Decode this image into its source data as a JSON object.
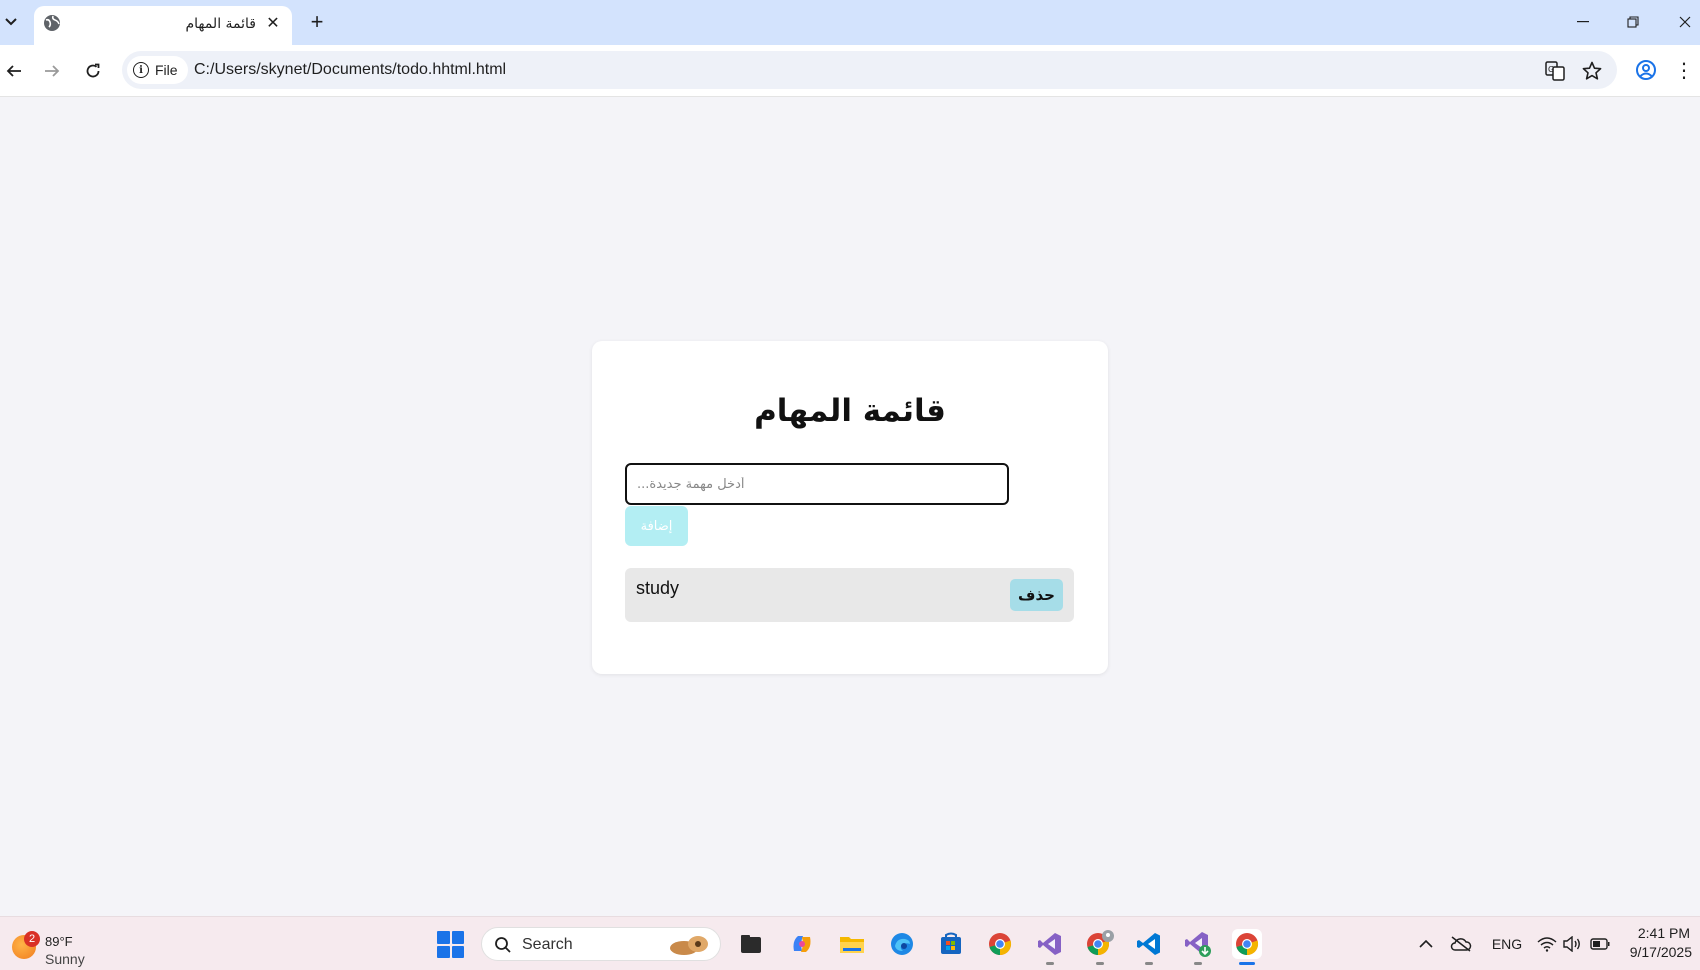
{
  "browser": {
    "tab": {
      "title": "قائمة المهام"
    },
    "address_bar": {
      "chip_label": "File",
      "url": "C:/Users/skynet/Documents/todo.hhtml.html"
    }
  },
  "page": {
    "title": "قائمة المهام",
    "input": {
      "placeholder": "أدخل مهمة جديدة...",
      "value": ""
    },
    "add_button_label": "إضافة",
    "tasks": [
      {
        "text": "study",
        "delete_label": "حذف"
      }
    ]
  },
  "taskbar": {
    "weather": {
      "badge": "2",
      "temp": "89°F",
      "condition": "Sunny"
    },
    "search_label": "Search",
    "apps": [
      "files-app",
      "copilot-app",
      "file-explorer-app",
      "edge-app",
      "store-app",
      "chrome-app",
      "visual-studio-app",
      "chrome-profile-app",
      "vscode-app",
      "visual-studio-installer-app",
      "chrome-active-app"
    ],
    "tray": {
      "language": "ENG"
    },
    "clock": {
      "time": "2:41 PM",
      "date": "9/17/2025"
    }
  }
}
